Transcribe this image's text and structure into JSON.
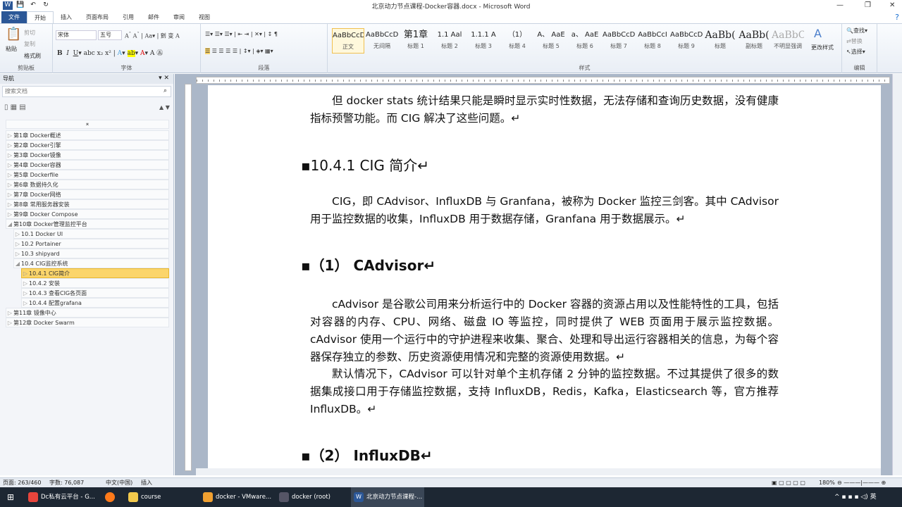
{
  "window": {
    "title": "北京动力节点课程-Docker容器.docx - Microsoft Word"
  },
  "tabs": [
    "文件",
    "开始",
    "插入",
    "页面布局",
    "引用",
    "邮件",
    "审阅",
    "视图"
  ],
  "ribbon": {
    "clipboard": {
      "label": "剪贴板",
      "paste": "粘贴",
      "cut": "剪切",
      "copy": "复制",
      "format_painter": "格式刷"
    },
    "font": {
      "label": "字体",
      "name": "宋体",
      "size": "五号"
    },
    "paragraph": {
      "label": "段落"
    },
    "styles": {
      "label": "样式",
      "items": [
        {
          "preview": "AaBbCcDd",
          "name": "正文"
        },
        {
          "preview": "AaBbCcDd",
          "name": "无间隔"
        },
        {
          "preview": "第1章",
          "name": "标题 1"
        },
        {
          "preview": "1.1 Aal",
          "name": "标题 2"
        },
        {
          "preview": "1.1.1 A",
          "name": "标题 3"
        },
        {
          "preview": "（1）",
          "name": "标题 4"
        },
        {
          "preview": "A、 AaE",
          "name": "标题 5"
        },
        {
          "preview": "a、 AaE",
          "name": "标题 6"
        },
        {
          "preview": "AaBbCcD",
          "name": "标题 7"
        },
        {
          "preview": "AaBbCcI",
          "name": "标题 8"
        },
        {
          "preview": "AaBbCcD",
          "name": "标题 9"
        },
        {
          "preview": "AaBb(",
          "name": "标题"
        },
        {
          "preview": "AaBb(",
          "name": "副标题"
        },
        {
          "preview": "AaBbCcDd",
          "name": "不明显强调"
        }
      ],
      "change_styles": "更改样式"
    },
    "editing": {
      "label": "编辑",
      "find": "查找",
      "replace": "替换",
      "select": "选择"
    }
  },
  "nav": {
    "title": "导航",
    "search_placeholder": "搜索文档",
    "items": [
      {
        "label": "第1章 Docker概述",
        "level": 0
      },
      {
        "label": "第2章  Docker引擎",
        "level": 0
      },
      {
        "label": "第3章 Docker镜像",
        "level": 0
      },
      {
        "label": "第4章 Docker容器",
        "level": 0
      },
      {
        "label": "第5章 Dockerfile",
        "level": 0
      },
      {
        "label": "第6章 数据持久化",
        "level": 0
      },
      {
        "label": "第7章 Docker网络",
        "level": 0
      },
      {
        "label": "第8章 常用服务器安装",
        "level": 0
      },
      {
        "label": "第9章 Docker Compose",
        "level": 0
      },
      {
        "label": "第10章 Docker管理监控平台",
        "level": 0,
        "open": true
      },
      {
        "label": "10.1 Docker UI",
        "level": 1
      },
      {
        "label": "10.2 Portainer",
        "level": 1
      },
      {
        "label": "10.3 shipyard",
        "level": 1
      },
      {
        "label": "10.4 CIG监控系统",
        "level": 1,
        "open": true
      },
      {
        "label": "10.4.1 CIG简介",
        "level": 2,
        "selected": true
      },
      {
        "label": "10.4.2 安装",
        "level": 2
      },
      {
        "label": "10.4.3 查看CIG各页面",
        "level": 2
      },
      {
        "label": "10.4.4 配置grafana",
        "level": 2
      },
      {
        "label": "第11章 镜像中心",
        "level": 0
      },
      {
        "label": "第12章 Docker Swarm",
        "level": 0
      }
    ]
  },
  "document": {
    "p1": "但 docker stats 统计结果只能是瞬时显示实时性数据，无法存储和查询历史数据，没有健康指标预警功能。而 CIG 解决了这些问题。↵",
    "h1": "10.4.1  CIG 简介↵",
    "p2": "CIG，即 CAdvisor、InfluxDB 与 Granfana，被称为 Docker 监控三剑客。其中 CAdvisor 用于监控数据的收集，InfluxDB 用于数据存储，Granfana 用于数据展示。↵",
    "h2": "（1） CAdvisor↵",
    "p3": "cAdvisor 是谷歌公司用来分析运行中的 Docker 容器的资源占用以及性能特性的工具，包括对容器的内存、CPU、网络、磁盘 IO 等监控，同时提供了 WEB 页面用于展示监控数据。cAdvisor 使用一个运行中的守护进程来收集、聚合、处理和导出运行容器相关的信息，为每个容器保存独立的参数、历史资源使用情况和完整的资源使用数据。↵",
    "p4": "默认情况下，CAdvisor 可以针对单个主机存储 2 分钟的监控数据。不过其提供了很多的数据集成接口用于存储监控数据，支持 InfluxDB，Redis，Kafka，Elasticsearch 等，官方推荐 InfluxDB。↵",
    "h3": "（2） InfluxDB↵"
  },
  "status": {
    "page": "页面: 263/460",
    "words": "字数: 76,087",
    "lang": "中文(中国)",
    "mode": "插入",
    "zoom": "180%"
  },
  "taskbar": [
    {
      "label": "Dc私有云平台 - G..."
    },
    {
      "label": ""
    },
    {
      "label": "course"
    },
    {
      "label": "docker - VMware..."
    },
    {
      "label": "docker (root)"
    },
    {
      "label": "北京动力节点课程-..."
    }
  ],
  "tray": {
    "ime": "英"
  }
}
